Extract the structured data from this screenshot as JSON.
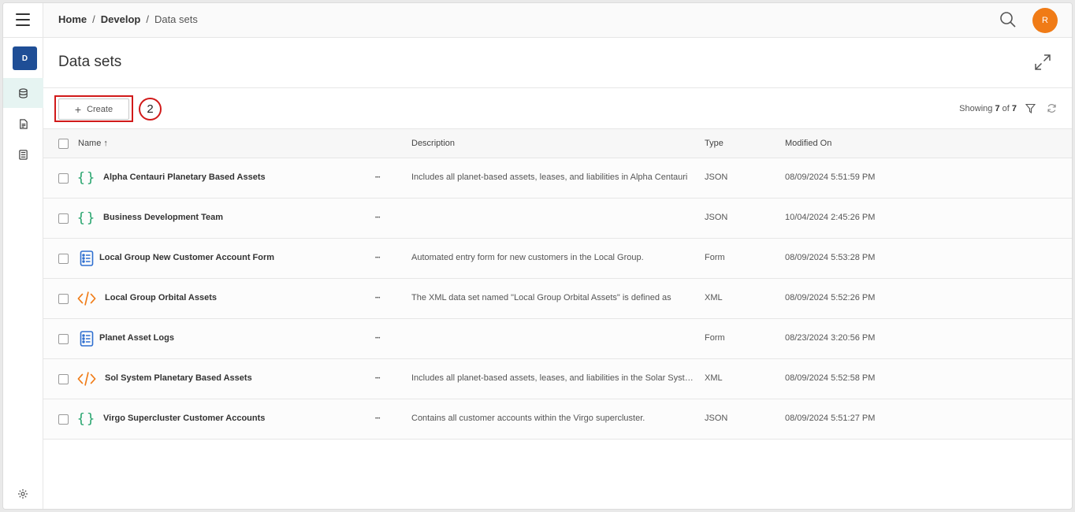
{
  "sidebar": {
    "workspace_initial": "D",
    "icons": [
      "menu-icon",
      "database-icon",
      "report-icon",
      "form-icon",
      "settings-icon"
    ]
  },
  "breadcrumb": {
    "items": [
      "Home",
      "Develop"
    ],
    "current": "Data sets",
    "separator": "/"
  },
  "header": {
    "avatar_initial": "R",
    "avatar_color": "#f07b16"
  },
  "page": {
    "title": "Data sets"
  },
  "toolbar": {
    "create_label": "Create",
    "step_number": "2",
    "showing_prefix": "Showing",
    "showing_count": "7",
    "showing_of": "of",
    "showing_total": "7"
  },
  "table": {
    "columns": {
      "name": "Name",
      "sort_indicator": "↑",
      "description": "Description",
      "type": "Type",
      "modified": "Modified On"
    },
    "rows": [
      {
        "icon": "json",
        "name": "Alpha Centauri Planetary Based Assets",
        "description": "Includes all planet-based assets, leases, and liabilities in Alpha Centauri",
        "type": "JSON",
        "modified": "08/09/2024 5:51:59 PM"
      },
      {
        "icon": "json",
        "name": "Business Development Team",
        "description": "",
        "type": "JSON",
        "modified": "10/04/2024 2:45:26 PM"
      },
      {
        "icon": "form",
        "name": "Local Group New Customer Account Form",
        "description": "Automated entry form for new customers in the Local Group.",
        "type": "Form",
        "modified": "08/09/2024 5:53:28 PM"
      },
      {
        "icon": "xml",
        "name": "Local Group Orbital Assets",
        "description": "The XML data set named \"Local Group Orbital Assets\" is defined as",
        "type": "XML",
        "modified": "08/09/2024 5:52:26 PM"
      },
      {
        "icon": "form",
        "name": "Planet Asset Logs",
        "description": "",
        "type": "Form",
        "modified": "08/23/2024 3:20:56 PM"
      },
      {
        "icon": "xml",
        "name": "Sol System Planetary Based Assets",
        "description": "Includes all planet-based assets, leases, and liabilities in the Solar System",
        "type": "XML",
        "modified": "08/09/2024 5:52:58 PM"
      },
      {
        "icon": "json",
        "name": "Virgo Supercluster Customer Accounts",
        "description": "Contains all customer accounts within the Virgo supercluster.",
        "type": "JSON",
        "modified": "08/09/2024 5:51:27 PM"
      }
    ]
  },
  "colors": {
    "json_icon": "#23a36b",
    "form_icon": "#2f6fd0",
    "xml_icon": "#f07b16",
    "workspace_badge": "#1f4e96",
    "highlight": "#d11a1a"
  }
}
